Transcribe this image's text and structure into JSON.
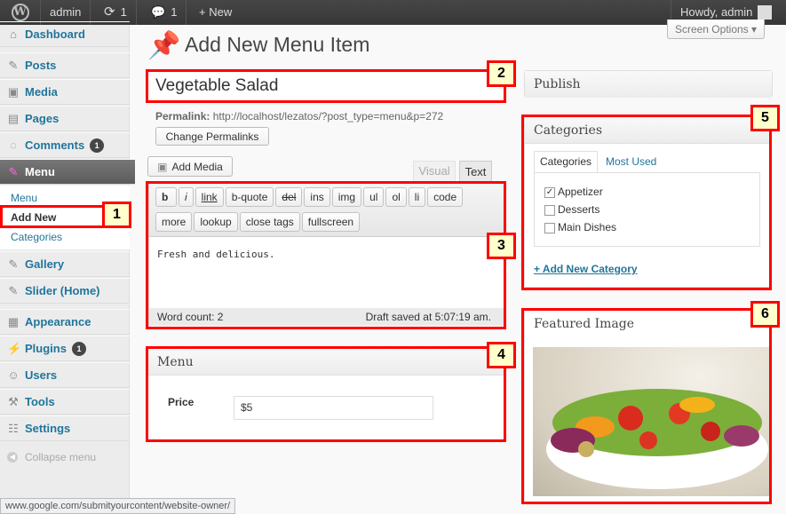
{
  "adminbar": {
    "site": "admin",
    "updates": "1",
    "comments": "1",
    "new": "+ New",
    "howdy": "Howdy, admin"
  },
  "sidebar": {
    "items": [
      {
        "label": "Dashboard",
        "icon": "home-icon"
      },
      {
        "label": "Posts",
        "icon": "pin-icon"
      },
      {
        "label": "Media",
        "icon": "media-icon"
      },
      {
        "label": "Pages",
        "icon": "pages-icon"
      },
      {
        "label": "Comments",
        "icon": "comment-icon",
        "badge": "1"
      },
      {
        "label": "Menu",
        "icon": "pin-icon"
      },
      {
        "label": "Gallery",
        "icon": "pin-icon"
      },
      {
        "label": "Slider (Home)",
        "icon": "pin-icon"
      },
      {
        "label": "Appearance",
        "icon": "appearance-icon"
      },
      {
        "label": "Plugins",
        "icon": "plugin-icon",
        "badge": "1"
      },
      {
        "label": "Users",
        "icon": "users-icon"
      },
      {
        "label": "Tools",
        "icon": "tools-icon"
      },
      {
        "label": "Settings",
        "icon": "settings-icon"
      }
    ],
    "submenu": [
      "Menu",
      "Add New",
      "Categories"
    ],
    "collapse": "Collapse menu"
  },
  "screen_options": "Screen Options",
  "page_title": "Add New Menu Item",
  "post_title": "Vegetable Salad",
  "permalink": {
    "label": "Permalink:",
    "url": "http://localhost/lezatos/?post_type=menu&p=272",
    "button": "Change Permalinks"
  },
  "editor": {
    "add_media": "Add Media",
    "tabs": [
      "Visual",
      "Text"
    ],
    "quicktags": [
      "b",
      "i",
      "link",
      "b-quote",
      "del",
      "ins",
      "img",
      "ul",
      "ol",
      "li",
      "code",
      "more",
      "lookup",
      "close tags",
      "fullscreen"
    ],
    "content": "Fresh and delicious.",
    "word_count": "Word count: 2",
    "draft_saved": "Draft saved at 5:07:19 am."
  },
  "menu_box": {
    "title": "Menu",
    "price_label": "Price",
    "price_value": "$5"
  },
  "publish": {
    "title": "Publish"
  },
  "categories": {
    "title": "Categories",
    "tabs": [
      "Categories",
      "Most Used"
    ],
    "items": [
      {
        "label": "Appetizer",
        "checked": true
      },
      {
        "label": "Desserts",
        "checked": false
      },
      {
        "label": "Main Dishes",
        "checked": false
      }
    ],
    "add_new": "+ Add New Category"
  },
  "featured": {
    "title": "Featured Image"
  },
  "callouts": [
    "1",
    "2",
    "3",
    "4",
    "5",
    "6"
  ],
  "status_url": "www.google.com/submityourcontent/website-owner/"
}
